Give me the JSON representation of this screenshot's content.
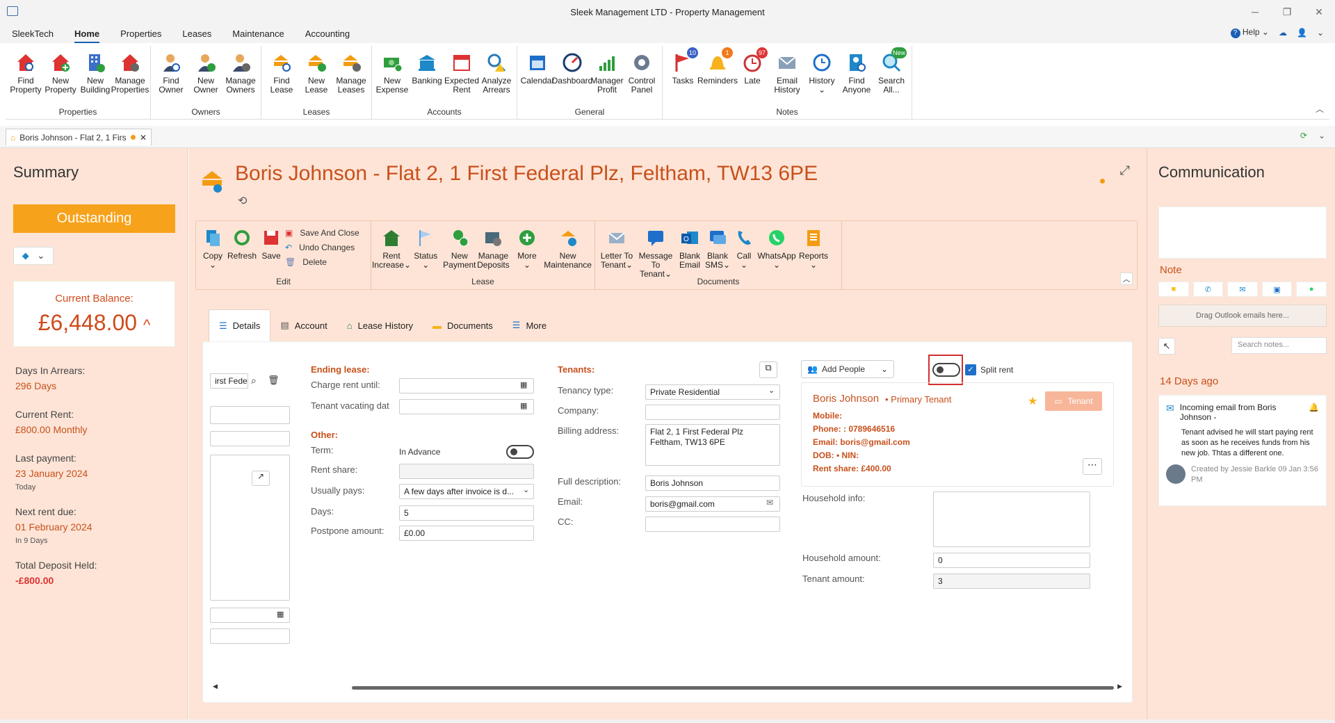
{
  "window": {
    "title": "Sleek Management LTD - Property Management"
  },
  "menu": {
    "items": [
      "SleekTech",
      "Home",
      "Properties",
      "Leases",
      "Maintenance",
      "Accounting"
    ],
    "help": "Help"
  },
  "ribbon": {
    "groups": [
      {
        "label": "Properties",
        "buttons": [
          {
            "l1": "Find",
            "l2": "Property"
          },
          {
            "l1": "New",
            "l2": "Property"
          },
          {
            "l1": "New",
            "l2": "Building"
          },
          {
            "l1": "Manage",
            "l2": "Properties"
          }
        ]
      },
      {
        "label": "Owners",
        "buttons": [
          {
            "l1": "Find",
            "l2": "Owner"
          },
          {
            "l1": "New",
            "l2": "Owner"
          },
          {
            "l1": "Manage",
            "l2": "Owners"
          }
        ]
      },
      {
        "label": "Leases",
        "buttons": [
          {
            "l1": "Find",
            "l2": "Lease"
          },
          {
            "l1": "New",
            "l2": "Lease"
          },
          {
            "l1": "Manage",
            "l2": "Leases"
          }
        ]
      },
      {
        "label": "Accounts",
        "buttons": [
          {
            "l1": "New",
            "l2": "Expense"
          },
          {
            "l1": "Banking",
            "l2": ""
          },
          {
            "l1": "Expected",
            "l2": "Rent"
          },
          {
            "l1": "Analyze",
            "l2": "Arrears"
          }
        ]
      },
      {
        "label": "General",
        "buttons": [
          {
            "l1": "Calendar",
            "l2": ""
          },
          {
            "l1": "Dashboard",
            "l2": ""
          },
          {
            "l1": "Manager",
            "l2": "Profit"
          },
          {
            "l1": "Control",
            "l2": "Panel"
          }
        ]
      },
      {
        "label": "Notes",
        "buttons": [
          {
            "l1": "Tasks",
            "l2": "",
            "badge": "10"
          },
          {
            "l1": "Reminders",
            "l2": "",
            "badge": "1"
          },
          {
            "l1": "Late",
            "l2": "",
            "badge": "97"
          },
          {
            "l1": "Email",
            "l2": "History"
          },
          {
            "l1": "History",
            "l2": ""
          },
          {
            "l1": "Find",
            "l2": "Anyone"
          },
          {
            "l1": "Search",
            "l2": "All...",
            "badge": "New"
          }
        ]
      }
    ]
  },
  "doc_tab": {
    "label": "Boris Johnson - Flat 2, 1 Firs"
  },
  "summary": {
    "title": "Summary",
    "status": "Outstanding",
    "balance_label": "Current Balance:",
    "balance": "£6,448.00",
    "days_arrears_label": "Days In Arrears:",
    "days_arrears": "296 Days",
    "current_rent_label": "Current Rent:",
    "current_rent": "£800.00 Monthly",
    "last_payment_label": "Last payment:",
    "last_payment": "23 January 2024",
    "last_payment_sub": "Today",
    "next_rent_label": "Next rent due:",
    "next_rent": "01 February 2024",
    "next_rent_sub": "In 9 Days",
    "deposit_label": "Total Deposit Held:",
    "deposit": "-£800.00"
  },
  "lease": {
    "title": "Boris Johnson - Flat 2, 1 First Federal Plz, Feltham, TW13 6PE"
  },
  "lease_ribbon": {
    "edit": {
      "label": "Edit",
      "buttons": [
        {
          "l1": "Copy"
        },
        {
          "l1": "Refresh"
        },
        {
          "l1": "Save"
        }
      ],
      "small": [
        "Save And Close",
        "Undo Changes",
        "Delete"
      ]
    },
    "lease": {
      "label": "Lease",
      "buttons": [
        {
          "l1": "Rent",
          "l2": "Increase"
        },
        {
          "l1": "Status",
          "l2": ""
        },
        {
          "l1": "New",
          "l2": "Payment"
        },
        {
          "l1": "Manage",
          "l2": "Deposits"
        },
        {
          "l1": "More",
          "l2": ""
        },
        {
          "l1": "New",
          "l2": "Maintenance"
        }
      ]
    },
    "docs": {
      "label": "Documents",
      "buttons": [
        {
          "l1": "Letter To",
          "l2": "Tenant"
        },
        {
          "l1": "Message",
          "l2": "To Tenant"
        },
        {
          "l1": "Blank",
          "l2": "Email"
        },
        {
          "l1": "Blank",
          "l2": "SMS"
        },
        {
          "l1": "Call",
          "l2": ""
        },
        {
          "l1": "WhatsApp",
          "l2": ""
        },
        {
          "l1": "Reports",
          "l2": ""
        }
      ]
    }
  },
  "tabs": [
    "Details",
    "Account",
    "Lease History",
    "Documents",
    "More"
  ],
  "details": {
    "left_field": "irst Fede",
    "ending_lease": "Ending lease:",
    "charge_until": "Charge rent until:",
    "tenant_vacating": "Tenant vacating dat",
    "other": "Other:",
    "term": "Term:",
    "term_value": "In Advance",
    "rent_share": "Rent share:",
    "usually_pays": "Usually pays:",
    "usually_pays_value": "A few days after invoice is d...",
    "days": "Days:",
    "days_value": "5",
    "postpone": "Postpone amount:",
    "postpone_value": "£0.00",
    "tenants": "Tenants:",
    "tenancy_type": "Tenancy type:",
    "tenancy_type_value": "Private Residential",
    "company": "Company:",
    "billing_address": "Billing address:",
    "billing_line1": "Flat 2, 1 First Federal Plz",
    "billing_line2": "Feltham, TW13 6PE",
    "full_description": "Full description:",
    "full_description_value": "Boris Johnson",
    "email": "Email:",
    "email_value": "boris@gmail.com",
    "cc": "CC:",
    "add_people": "Add People",
    "split_rent": "Split rent",
    "tenant_name": "Boris Johnson",
    "tenant_role": "• Primary Tenant",
    "tenant_badge": "Tenant",
    "mobile": "Mobile:",
    "phone": "Phone: : 0789646516",
    "email_line": "Email: boris@gmail.com",
    "dob": "DOB:   • NIN:",
    "rent_share_line": "Rent share: £400.00",
    "household_info": "Household info:",
    "household_amount": "Household amount:",
    "household_amount_value": "0",
    "tenant_amount": "Tenant amount:",
    "tenant_amount_value": "3"
  },
  "communication": {
    "title": "Communication",
    "note_label": "Note",
    "drag": "Drag Outlook emails here...",
    "search_placeholder": "Search notes...",
    "days_ago": "14 Days ago",
    "email_title": "Incoming email from Boris Johnson -",
    "email_body": "Tenant advised he will start paying rent as soon as he receives funds from his new job. Thtas a different one.",
    "created_by": "Created by Jessie Barkle 09 Jan 3:56 PM"
  },
  "colors": {
    "accent": "#c8501b",
    "outstanding": "#f7a21b",
    "panel": "#fde4d6"
  }
}
